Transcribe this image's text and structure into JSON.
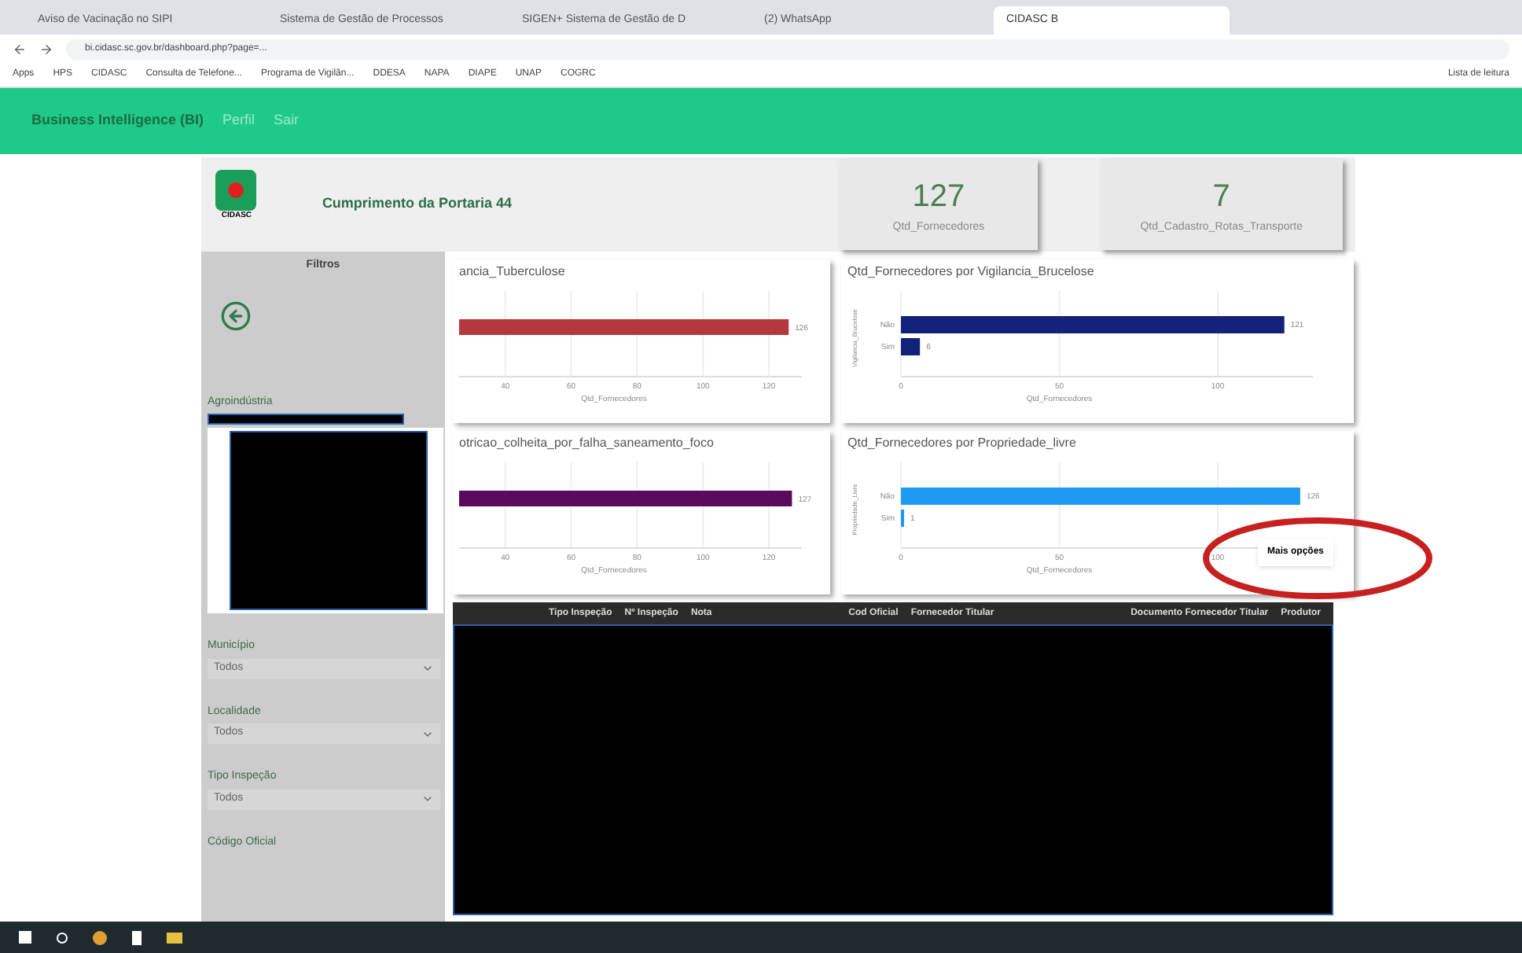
{
  "browser": {
    "tabs": [
      {
        "title": "Aviso de Vacinação no SIPI",
        "selected": false
      },
      {
        "title": "Sistema de Gestão de Processos",
        "selected": false
      },
      {
        "title": "SIGEN+ Sistema de Gestão de D",
        "selected": false
      },
      {
        "title": "(2) WhatsApp",
        "selected": false
      },
      {
        "title": "CIDASC B",
        "selected": true
      }
    ],
    "url": "bi.cidasc.sc.gov.br/dashboard.php?page=...",
    "bookmarks": [
      "Apps",
      "HPS",
      "CIDASC",
      "Consulta de Telefone...",
      "Programa de Vigilân...",
      "DDESA",
      "NAPA",
      "DIAPE",
      "UNAP",
      "COGRC"
    ],
    "reading_list": "Lista de leitura"
  },
  "navbar": {
    "title": "Business Intelligence (BI)",
    "links": [
      "Perfil",
      "Sair"
    ]
  },
  "report": {
    "logo_text": "CIDASC",
    "title": "Cumprimento da Portaria 44",
    "kpis": [
      {
        "value": "127",
        "label": "Qtd_Fornecedores"
      },
      {
        "value": "7",
        "label": "Qtd_Cadastro_Rotas_Transporte"
      }
    ],
    "filters": {
      "title": "Filtros",
      "slicers": [
        {
          "label": "Agroindústria",
          "kind": "list"
        },
        {
          "label": "Município",
          "kind": "dropdown",
          "value": "Todos"
        },
        {
          "label": "Localidade",
          "kind": "dropdown",
          "value": "Todos"
        },
        {
          "label": "Tipo Inspeção",
          "kind": "dropdown",
          "value": "Todos"
        },
        {
          "label": "Código Oficial",
          "kind": "header"
        }
      ]
    },
    "charts": [
      {
        "chart_data": {
          "type": "bar",
          "orientation": "horizontal",
          "title": "ancia_Tuberculose",
          "xlabel": "Qtd_Fornecedores",
          "series": [
            {
              "color": "#b5393c",
              "values": [
                126
              ]
            }
          ],
          "xlim": [
            26,
            130
          ],
          "xticks": [
            40,
            60,
            80,
            100,
            120
          ],
          "grid": true,
          "data_labels": true
        }
      },
      {
        "chart_data": {
          "type": "bar",
          "orientation": "horizontal",
          "title": "Qtd_Fornecedores por Vigilancia_Brucelose",
          "xlabel": "Qtd_Fornecedores",
          "ylabel": "Vigilancia_Brucelose",
          "categories": [
            "Não",
            "Sim"
          ],
          "series": [
            {
              "color": "#12227a",
              "values": [
                121,
                6
              ]
            }
          ],
          "xlim": [
            0,
            130
          ],
          "xticks": [
            0,
            50,
            100
          ],
          "grid": true,
          "data_labels": true
        }
      },
      {
        "chart_data": {
          "type": "bar",
          "orientation": "horizontal",
          "title": "otricao_colheita_por_falha_saneamento_foco",
          "xlabel": "Qtd_Fornecedores",
          "series": [
            {
              "color": "#5b0a5e",
              "values": [
                127
              ]
            }
          ],
          "xlim": [
            26,
            130
          ],
          "xticks": [
            40,
            60,
            80,
            100,
            120
          ],
          "grid": true,
          "data_labels": true
        }
      },
      {
        "chart_data": {
          "type": "bar",
          "orientation": "horizontal",
          "title": "Qtd_Fornecedores por Propriedade_livre",
          "xlabel": "Qtd_Fornecedores",
          "ylabel": "Propriedade_Livre",
          "categories": [
            "Não",
            "Sim"
          ],
          "series": [
            {
              "color": "#1e9af0",
              "values": [
                126,
                1
              ]
            }
          ],
          "xlim": [
            0,
            130
          ],
          "xticks": [
            0,
            50,
            100
          ],
          "grid": true,
          "data_labels": true
        }
      }
    ],
    "tooltip": "Mais opções",
    "table": {
      "columns": [
        "Tipo Inspeção",
        "Nº Inspeção",
        "Nota",
        "Cod Oficial",
        "Fornecedor Titular",
        "Documento Fornecedor Titular",
        "Produtor"
      ]
    }
  }
}
